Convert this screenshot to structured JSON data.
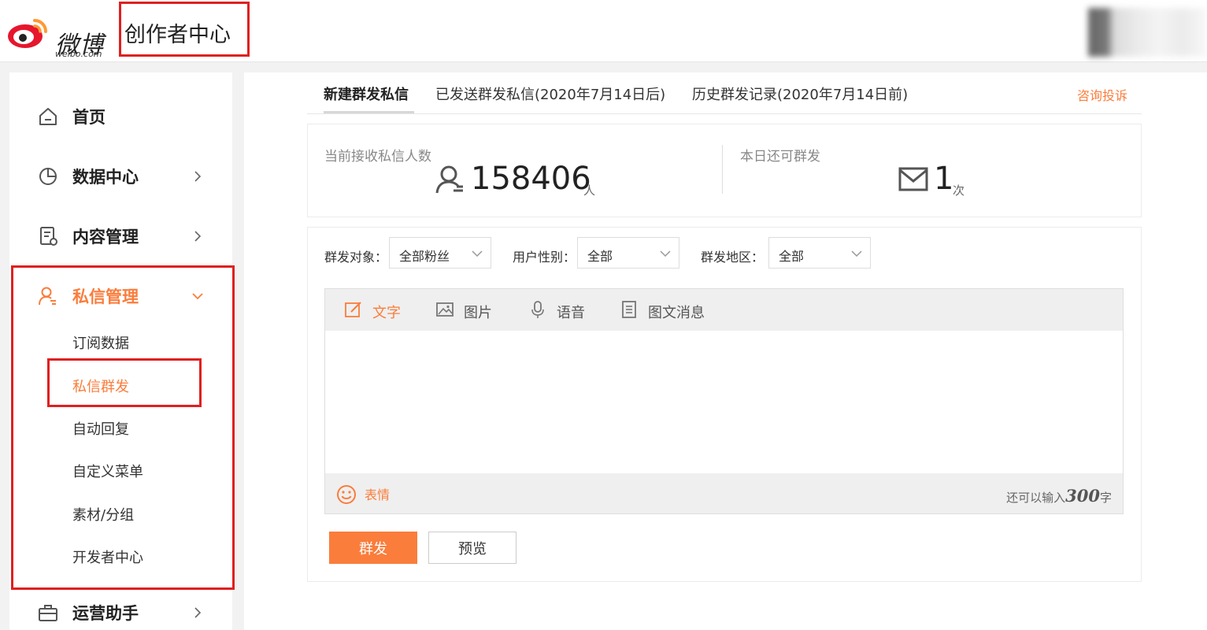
{
  "header": {
    "logo_text": "微博",
    "logo_sub": "weibo.com",
    "app_title": "创作者中心"
  },
  "sidebar": {
    "items": [
      {
        "label": "首页",
        "icon": "home-icon"
      },
      {
        "label": "数据中心",
        "icon": "pie-chart-icon"
      },
      {
        "label": "内容管理",
        "icon": "document-icon"
      },
      {
        "label": "私信管理",
        "icon": "user-message-icon",
        "expanded": true
      },
      {
        "label": "运营助手",
        "icon": "briefcase-icon"
      }
    ],
    "sub_items": [
      "订阅数据",
      "私信群发",
      "自动回复",
      "自定义菜单",
      "素材/分组",
      "开发者中心"
    ],
    "active_sub": "私信群发"
  },
  "tabs": [
    {
      "label": "新建群发私信",
      "active": true
    },
    {
      "label": "已发送群发私信(2020年7月14日后)"
    },
    {
      "label": "历史群发记录(2020年7月14日前)"
    }
  ],
  "complain_label": "咨询投诉",
  "stats": {
    "receivers_label": "当前接收私信人数",
    "receivers_value": "158406",
    "receivers_unit": "人",
    "remaining_label": "本日还可群发",
    "remaining_value": "1",
    "remaining_unit": "次"
  },
  "filters": {
    "target_label": "群发对象：",
    "target_value": "全部粉丝",
    "gender_label": "用户性别：",
    "gender_value": "全部",
    "region_label": "群发地区：",
    "region_value": "全部"
  },
  "editor": {
    "tools": [
      {
        "label": "文字",
        "icon": "edit-icon",
        "active": true
      },
      {
        "label": "图片",
        "icon": "image-icon"
      },
      {
        "label": "语音",
        "icon": "microphone-icon"
      },
      {
        "label": "图文消息",
        "icon": "article-icon"
      }
    ],
    "emoji_label": "表情",
    "remain_prefix": "还可以输入",
    "remain_count": "300",
    "remain_suffix": "字"
  },
  "buttons": {
    "send": "群发",
    "preview": "预览"
  },
  "colors": {
    "accent": "#fa7d3c",
    "highlight_border": "#e02020"
  }
}
